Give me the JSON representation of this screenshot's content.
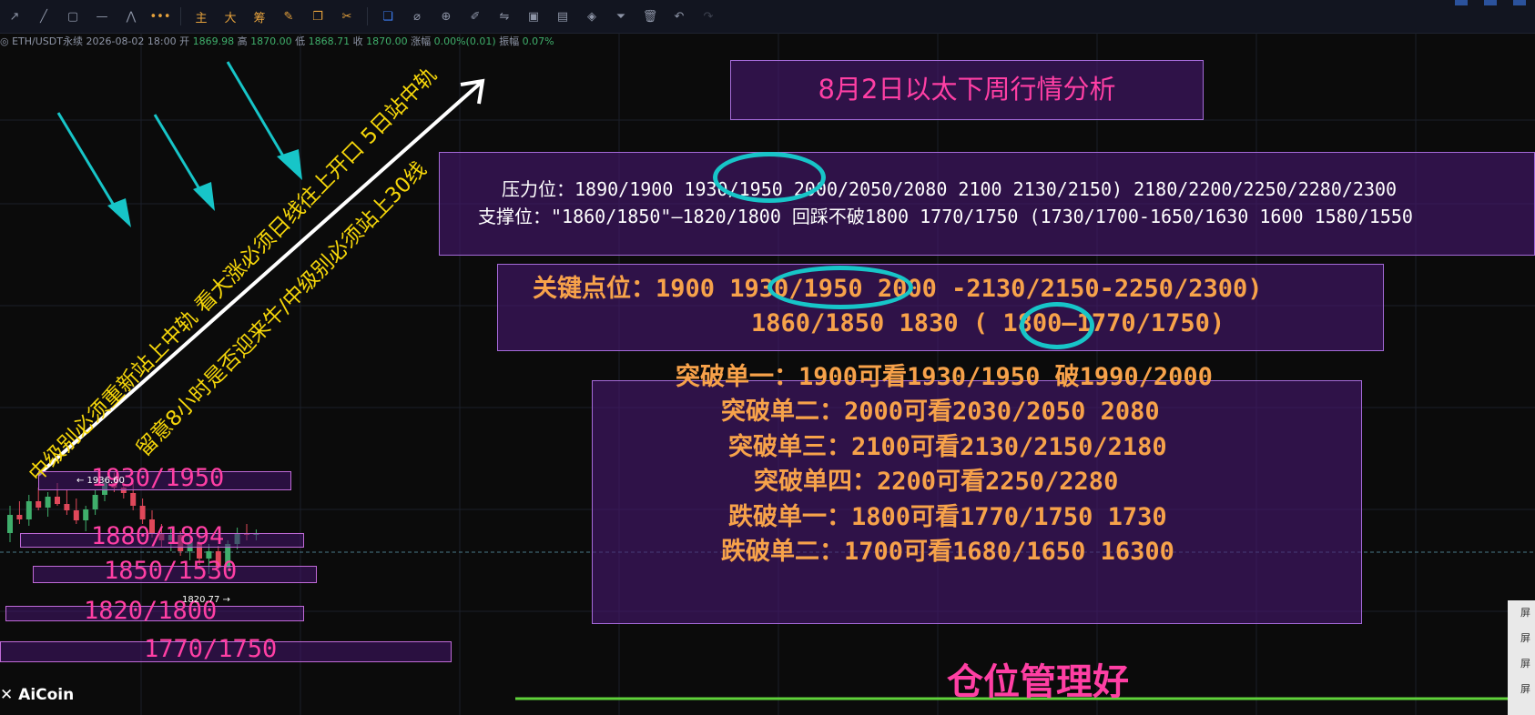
{
  "toolbar": {
    "left_icons": [
      "pointer-icon",
      "line-icon",
      "rectangle-icon",
      "horizontal-line-icon",
      "pattern-icon",
      "more-icon"
    ],
    "text_buttons": [
      "主",
      "大",
      "筹"
    ],
    "right_icons": [
      "layers-icon",
      "pin-icon",
      "zoom-icon",
      "brush-icon",
      "compare-icon",
      "lock-icon",
      "save-icon",
      "magnet-icon",
      "filter-icon",
      "trash-icon",
      "undo-icon",
      "redo-icon"
    ]
  },
  "ohlc": {
    "symbol": "ETH/USDT永续",
    "datetime": "2026-08-02 18:00",
    "open_label": "开",
    "open": "1869.98",
    "high_label": "高",
    "high": "1870.00",
    "low_label": "低",
    "low": "1868.71",
    "close_label": "收",
    "close": "1870.00",
    "change_label": "涨幅",
    "change": "0.00%(0.01)",
    "amp_label": "振幅",
    "amp": "0.07%"
  },
  "title": "8月2日以太下周行情分析",
  "resistance_line": "压力位：1890/1900 1930/1950 2000/2050/2080 2100 2130/2150) 2180/2200/2250/2280/2300",
  "support_line": "支撑位：\"1860/1850\"—1820/1800 回踩不破1800 1770/1750 (1730/1700-1650/1630 1600 1580/1550",
  "key_line1": "关键点位：1900 1930/1950 2000 -2130/2150-2250/2300)",
  "key_line2": "1860/1850 1830 ( 1800—1770/1750)",
  "breakouts": [
    "突破单一：1900可看1930/1950 破1990/2000",
    "突破单二：2000可看2030/2050 2080",
    "突破单三：2100可看2130/2150/2180",
    "突破单四：2200可看2250/2280",
    "跌破单一：1800可看1770/1750 1730",
    "跌破单二：1700可看1680/1650 16300"
  ],
  "levels": [
    "1930/1950",
    "1880/1894",
    "1850/1530",
    "1820/1800",
    "1770/1750"
  ],
  "diag_text_1": "中级别必须重新站上中轨  看大涨必须日线往上开口  5日站中轨",
  "diag_text_2": "留意8小时是否迎来牛/中级别必须站上30线",
  "price_high": "← 1936.60",
  "price_low": "1820.77 →",
  "warning": "仓位管理好",
  "logo": "AiCoin",
  "side_items": [
    "屏",
    "屏",
    "屏",
    "屏"
  ],
  "colors": {
    "accent_pink": "#ff3fa4",
    "accent_orange": "#f7a24a",
    "ring_cyan": "#17c5c8",
    "box_purple": "#46166e",
    "up_green": "#3fae6b",
    "down_red": "#e0485a"
  },
  "chart_data": {
    "type": "candlestick",
    "symbol": "ETH/USDT永续",
    "ohlc": [
      [
        1870,
        1900,
        1860,
        1890
      ],
      [
        1890,
        1905,
        1880,
        1885
      ],
      [
        1885,
        1912,
        1878,
        1905
      ],
      [
        1905,
        1920,
        1895,
        1898
      ],
      [
        1898,
        1915,
        1888,
        1910
      ],
      [
        1910,
        1925,
        1900,
        1902
      ],
      [
        1902,
        1918,
        1890,
        1895
      ],
      [
        1895,
        1908,
        1880,
        1884
      ],
      [
        1884,
        1900,
        1872,
        1896
      ],
      [
        1896,
        1918,
        1890,
        1912
      ],
      [
        1912,
        1930,
        1905,
        1925
      ],
      [
        1925,
        1936.6,
        1915,
        1920
      ],
      [
        1920,
        1932,
        1908,
        1914
      ],
      [
        1914,
        1925,
        1895,
        1900
      ],
      [
        1900,
        1908,
        1880,
        1885
      ],
      [
        1885,
        1895,
        1865,
        1870
      ],
      [
        1870,
        1880,
        1855,
        1862
      ],
      [
        1862,
        1875,
        1850,
        1868
      ],
      [
        1868,
        1872,
        1845,
        1850
      ],
      [
        1850,
        1866,
        1840,
        1860
      ],
      [
        1860,
        1870,
        1835,
        1842
      ],
      [
        1842,
        1858,
        1825,
        1850
      ],
      [
        1850,
        1856,
        1820.77,
        1832
      ],
      [
        1832,
        1862,
        1828,
        1858
      ],
      [
        1858,
        1876,
        1852,
        1870
      ],
      [
        1870,
        1880,
        1862,
        1868
      ],
      [
        1868,
        1874,
        1862,
        1870
      ]
    ],
    "annotations": {
      "high": 1936.6,
      "low": 1820.77
    }
  }
}
